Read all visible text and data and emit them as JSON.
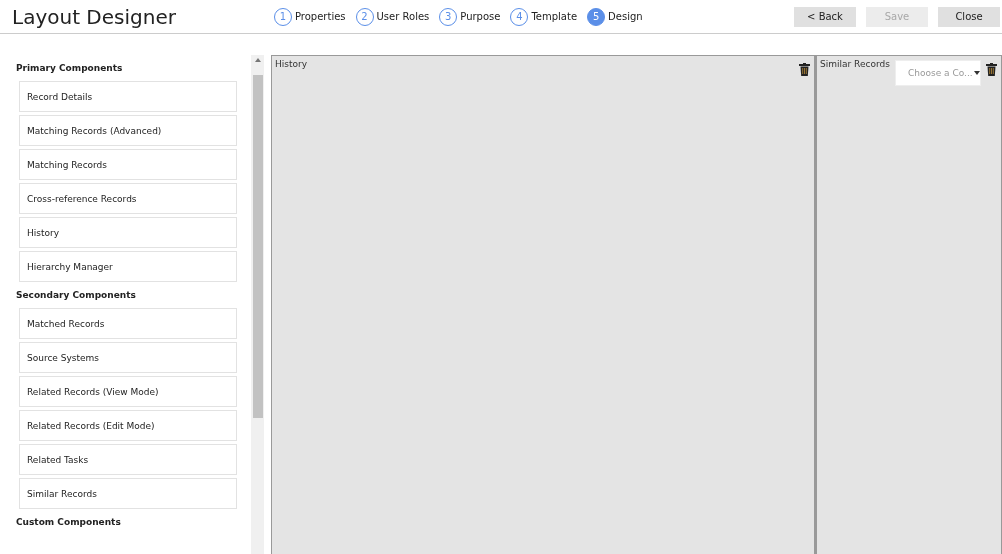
{
  "app": {
    "title": "Layout Designer"
  },
  "steps": [
    {
      "number": "1",
      "label": "Properties",
      "selected": false
    },
    {
      "number": "2",
      "label": "User Roles",
      "selected": false
    },
    {
      "number": "3",
      "label": "Purpose",
      "selected": false
    },
    {
      "number": "4",
      "label": "Template",
      "selected": false
    },
    {
      "number": "5",
      "label": "Design",
      "selected": true
    }
  ],
  "buttons": [
    {
      "label": "< Back",
      "disabled": false
    },
    {
      "label": "Save",
      "disabled": true
    },
    {
      "label": "Close",
      "disabled": false
    }
  ],
  "sidebar": {
    "groups": [
      {
        "title": "Primary Components",
        "items": [
          "Record Details",
          "Matching Records (Advanced)",
          "Matching Records",
          "Cross-reference Records",
          "History",
          "Hierarchy Manager"
        ]
      },
      {
        "title": "Secondary Components",
        "items": [
          "Matched Records",
          "Source Systems",
          "Related Records (View Mode)",
          "Related Records (Edit Mode)",
          "Related Tasks",
          "Similar Records"
        ]
      },
      {
        "title": "Custom Components"
      }
    ]
  },
  "panels": [
    {
      "title": "History"
    },
    {
      "title": "Similar Records",
      "dropdown": {
        "placeholder": "Choose a Co..."
      }
    }
  ]
}
